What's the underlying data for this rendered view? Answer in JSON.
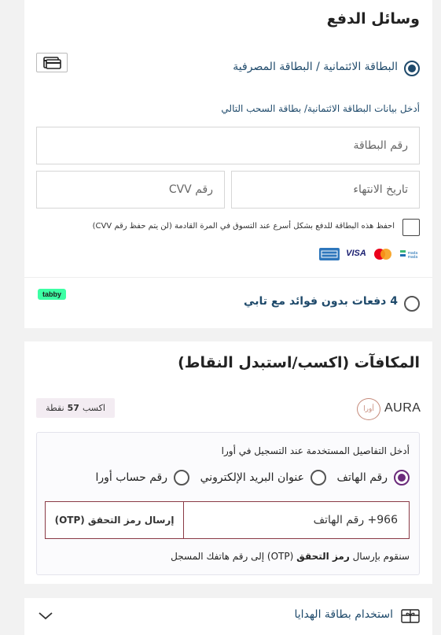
{
  "payment": {
    "title": "وسائل الدفع",
    "card_option_label": "البطاقة الائتمانية / البطاقة المصرفية",
    "card_instructions": "أدخل بيانات البطاقة الائتمانية/ بطاقة السحب التالي",
    "card_number_placeholder": "رقم البطاقة",
    "expiry_placeholder": "تاريخ الانتهاء",
    "cvv_placeholder": "رقم CVV",
    "save_card_label": "احفظ هذه البطاقة للدفع بشكل أسرع عند التسوق في المرة القادمة (لن يتم حفظ رقم CVV)",
    "brands": [
      "AMEX",
      "VISA",
      "Mastercard",
      "mada"
    ],
    "tabby_label": "4 دفعات بدون فوائد مع تابي",
    "tabby_badge": "tabby"
  },
  "rewards": {
    "title": "المكافآت (اكسب/استبدل النقاط)",
    "aura_brand": "AURA",
    "aura_arabic": "أورا",
    "earn_prefix": "اكسب",
    "earn_points": "57",
    "earn_suffix": "نقطة",
    "login_instructions": "أدخل التفاصيل المستخدمة عند التسجيل في أورا",
    "options": [
      "رقم الهاتف",
      "عنوان البريد الإلكتروني",
      "رقم حساب أورا"
    ],
    "phone_placeholder": "966+ رقم الهاتف",
    "send_otp_label": "إرسال رمز التحقق (OTP)",
    "otp_note_prefix": "سنقوم بإرسال",
    "otp_note_bold": "رمز التحقق",
    "otp_note_suffix": "(OTP) إلى رقم هاتفك المسجل"
  },
  "gift": {
    "label": "استخدام بطاقة الهدايا"
  },
  "colors": {
    "accent_dark": "#1f4a6b",
    "aura_purple": "#6b2b7b",
    "otp_border": "#8a3a45",
    "tabby_green": "#3cffa4"
  }
}
